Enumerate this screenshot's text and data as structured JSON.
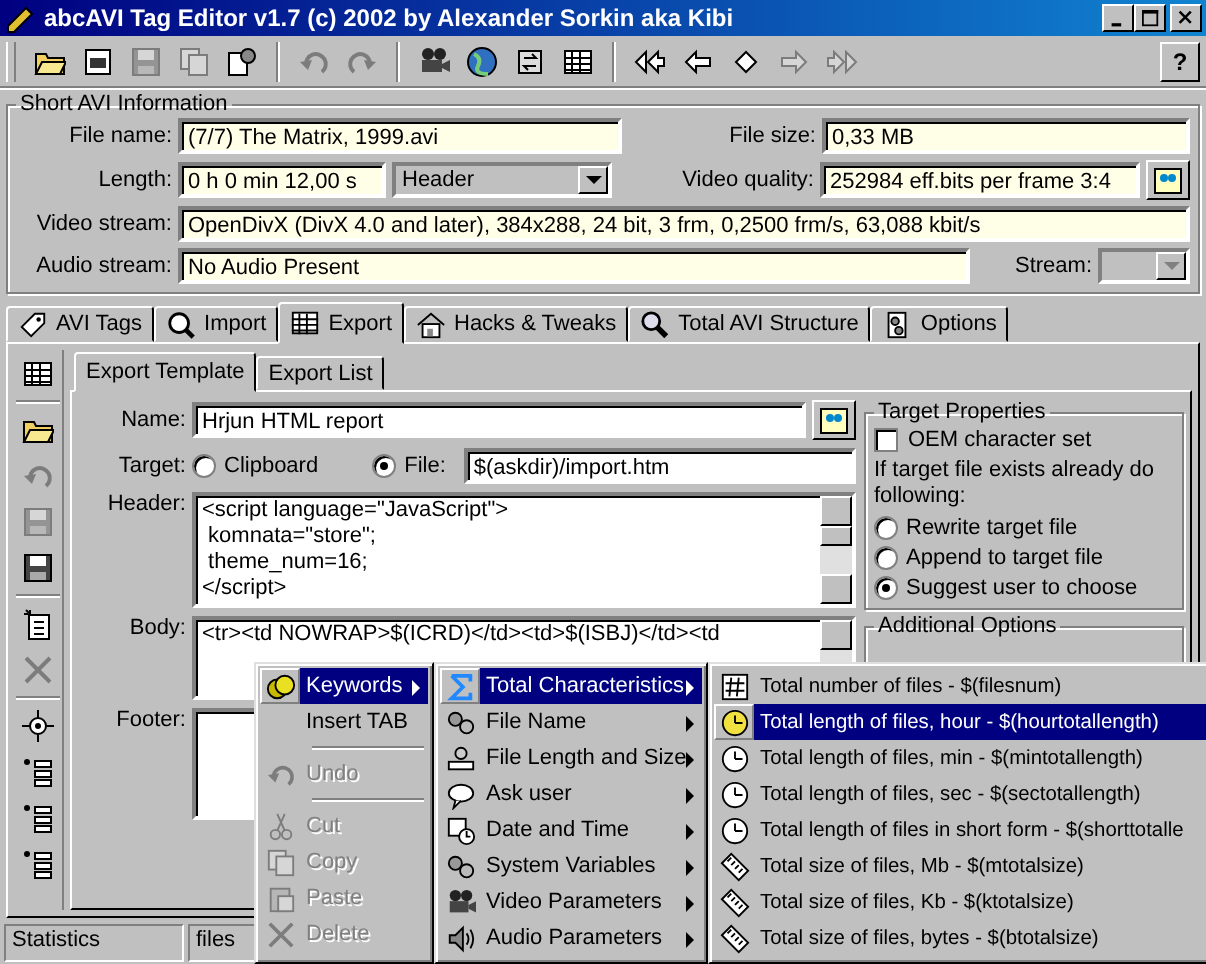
{
  "window": {
    "title": "abcAVI Tag Editor v1.7 (c) 2002 by Alexander Sorkin aka Kibi"
  },
  "toolbar": [
    [
      {
        "disabled": false
      },
      {
        "disabled": false
      },
      {
        "disabled": true
      },
      {
        "disabled": true
      },
      {
        "disabled": false
      }
    ],
    [
      {
        "disabled": true
      },
      {
        "disabled": true
      }
    ],
    [
      {
        "disabled": false
      },
      {
        "disabled": false
      },
      {
        "disabled": false
      },
      {
        "disabled": false
      }
    ],
    [
      {
        "disabled": false
      },
      {
        "disabled": false
      },
      {
        "disabled": false
      },
      {
        "disabled": true
      },
      {
        "disabled": true
      }
    ]
  ],
  "help_button": "?",
  "avi_info": {
    "title": "Short AVI Information",
    "file_name": {
      "label": "File name:",
      "value": "(7/7) The Matrix, 1999.avi"
    },
    "file_size": {
      "label": "File size:",
      "value": "0,33 MB"
    },
    "length": {
      "label": "Length:",
      "value": "0 h 0 min 12,00 s",
      "mode": "Header"
    },
    "video_quality": {
      "label": "Video quality:",
      "value": "252984 eff.bits per frame 3:4"
    },
    "video_stream": {
      "label": "Video stream:",
      "value": "OpenDivX (DivX 4.0 and later), 384x288, 24 bit, 3 frm, 0,2500 frm/s, 63,088 kbit/s"
    },
    "audio_stream": {
      "label": "Audio stream:",
      "value": "No Audio Present"
    },
    "stream": {
      "label": "Stream:",
      "disabled": true
    }
  },
  "tabs": [
    {
      "label": "AVI Tags",
      "selected": false
    },
    {
      "label": "Import",
      "selected": false
    },
    {
      "label": "Export",
      "selected": true
    },
    {
      "label": "Hacks & Tweaks",
      "selected": false
    },
    {
      "label": "Total AVI Structure",
      "selected": false
    },
    {
      "label": "Options",
      "selected": false
    }
  ],
  "subtabs": [
    {
      "label": "Export Template",
      "selected": true
    },
    {
      "label": "Export List",
      "selected": false
    }
  ],
  "side_toolbar": [
    {
      "kind": "button",
      "disabled": false
    },
    {
      "kind": "separator"
    },
    {
      "kind": "button",
      "disabled": false
    },
    {
      "kind": "button",
      "disabled": true
    },
    {
      "kind": "button",
      "disabled": true
    },
    {
      "kind": "button",
      "disabled": false
    },
    {
      "kind": "separator"
    },
    {
      "kind": "button",
      "disabled": false
    },
    {
      "kind": "button",
      "disabled": true
    },
    {
      "kind": "separator"
    },
    {
      "kind": "button",
      "disabled": false
    },
    {
      "kind": "button",
      "disabled": false
    },
    {
      "kind": "button",
      "disabled": false
    },
    {
      "kind": "button",
      "disabled": false
    }
  ],
  "template": {
    "name": {
      "label": "Name:",
      "value": "Hrjun HTML report"
    },
    "target": {
      "label": "Target:",
      "options": [
        {
          "label": "Clipboard",
          "selected": false
        },
        {
          "label": "File:",
          "selected": true
        }
      ],
      "file": "$(askdir)/import.htm"
    },
    "header": {
      "label": "Header:",
      "lines": [
        "<script language=\"JavaScript\">",
        " komnata=\"store\";",
        " theme_num=16;",
        "</script>"
      ]
    },
    "body": {
      "label": "Body:",
      "lines": [
        "<tr><td NOWRAP>$(ICRD)</td><td>$(ISBJ)</td><td"
      ]
    },
    "footer": {
      "label": "Footer:"
    }
  },
  "target_properties": {
    "title": "Target Properties",
    "oem": {
      "label": "OEM character set",
      "checked": false
    },
    "note": "If target file exists already do following:",
    "options": [
      {
        "label": "Rewrite target file",
        "selected": false
      },
      {
        "label": "Append to target file",
        "selected": false
      },
      {
        "label": "Suggest user to choose",
        "selected": true
      }
    ]
  },
  "additional_options": {
    "title": "Additional Options"
  },
  "status_bar": [
    "Statistics",
    "files"
  ],
  "context_menu": [
    {
      "kind": "item",
      "label": "Keywords",
      "selected": true,
      "submenu": true,
      "disabled": false
    },
    {
      "kind": "item",
      "label": "Insert TAB",
      "selected": false,
      "submenu": false,
      "disabled": false
    },
    {
      "kind": "separator"
    },
    {
      "kind": "item",
      "label": "Undo",
      "selected": false,
      "submenu": false,
      "disabled": true
    },
    {
      "kind": "separator"
    },
    {
      "kind": "item",
      "label": "Cut",
      "selected": false,
      "submenu": false,
      "disabled": true
    },
    {
      "kind": "item",
      "label": "Copy",
      "selected": false,
      "submenu": false,
      "disabled": true
    },
    {
      "kind": "item",
      "label": "Paste",
      "selected": false,
      "submenu": false,
      "disabled": true
    },
    {
      "kind": "item",
      "label": "Delete",
      "selected": false,
      "submenu": false,
      "disabled": true
    }
  ],
  "keywords_menu": [
    {
      "label": "Total Characteristics",
      "selected": true
    },
    {
      "label": "File Name",
      "selected": false
    },
    {
      "label": "File Length and Size",
      "selected": false
    },
    {
      "label": "Ask user",
      "selected": false
    },
    {
      "label": "Date and Time",
      "selected": false
    },
    {
      "label": "System Variables",
      "selected": false
    },
    {
      "label": "Video Parameters",
      "selected": false
    },
    {
      "label": "Audio Parameters",
      "selected": false
    }
  ],
  "total_menu": [
    {
      "label": "Total number of files - $(filesnum)",
      "selected": false
    },
    {
      "label": "Total length of files, hour - $(hourtotallength)",
      "selected": true
    },
    {
      "label": "Total length of files, min - $(mintotallength)",
      "selected": false
    },
    {
      "label": "Total length of files, sec - $(sectotallength)",
      "selected": false
    },
    {
      "label": "Total length of files in short form - $(shorttotalle",
      "selected": false
    },
    {
      "label": "Total size of files, Mb - $(mtotalsize)",
      "selected": false
    },
    {
      "label": "Total size of files, Kb - $(ktotalsize)",
      "selected": false
    },
    {
      "label": "Total size of files, bytes - $(btotalsize)",
      "selected": false
    }
  ]
}
